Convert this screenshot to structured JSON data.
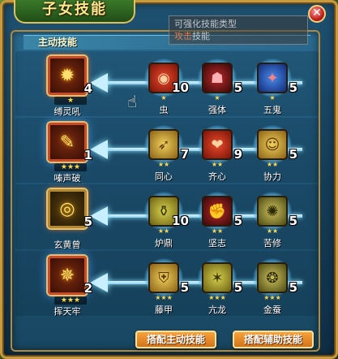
{
  "window": {
    "title": "子女技能",
    "close_label": "✕"
  },
  "tooltip": {
    "line1": "可强化技能类型",
    "line2_accent": "攻击",
    "line2_rest": "技能"
  },
  "section_title": "主动技能",
  "rows": [
    {
      "main": {
        "name": "缚灵吼",
        "level": "4",
        "stars": "★",
        "icon": "sun-burst-icon",
        "glyph": "✹"
      },
      "subs": [
        {
          "name": "虫",
          "level": "10",
          "stars": "★",
          "icon": "red-eye-icon",
          "glyph": "◉",
          "style": "ic-red"
        },
        {
          "name": "强体",
          "level": "5",
          "stars": "★",
          "icon": "demon-face-icon",
          "glyph": "☗",
          "style": "ic-darkred"
        },
        {
          "name": "五鬼",
          "level": "5",
          "stars": "★",
          "icon": "blue-ghost-icon",
          "glyph": "✦",
          "style": "ic-blue"
        }
      ]
    },
    {
      "main": {
        "name": "嗪声破",
        "level": "1",
        "stars": "★★★",
        "icon": "scroll-icon",
        "glyph": "✎"
      },
      "subs": [
        {
          "name": "同心",
          "level": "7",
          "stars": "★★",
          "icon": "horn-icon",
          "glyph": "➶",
          "style": "ic-gold"
        },
        {
          "name": "齐心",
          "level": "9",
          "stars": "★★",
          "icon": "heart-icon",
          "glyph": "❤",
          "style": "ic-red"
        },
        {
          "name": "协力",
          "level": "5",
          "stars": "★★",
          "icon": "character-icon",
          "glyph": "☺",
          "style": "ic-gold"
        }
      ]
    },
    {
      "main": {
        "name": "玄黄曾",
        "level": "5",
        "stars": "",
        "icon": "orb-icon",
        "glyph": "◎"
      },
      "subs": [
        {
          "name": "炉鼎",
          "level": "10",
          "stars": "★★",
          "icon": "cauldron-icon",
          "glyph": "⚱",
          "style": "ic-goldgreen"
        },
        {
          "name": "坚志",
          "level": "5",
          "stars": "★★",
          "icon": "fist-icon",
          "glyph": "✊",
          "style": "ic-darkred"
        },
        {
          "name": "苦修",
          "level": "5",
          "stars": "★★",
          "icon": "spiral-icon",
          "glyph": "✺",
          "style": "ic-olive"
        }
      ]
    },
    {
      "main": {
        "name": "挥天牢",
        "level": "2",
        "stars": "★★★",
        "icon": "flame-icon",
        "glyph": "✵"
      },
      "subs": [
        {
          "name": "藤甲",
          "level": "5",
          "stars": "★★★",
          "icon": "armor-icon",
          "glyph": "⛨",
          "style": "ic-gold"
        },
        {
          "name": "亢龙",
          "level": "5",
          "stars": "★★★",
          "icon": "dragon-icon",
          "glyph": "✶",
          "style": "ic-goldgreen"
        },
        {
          "name": "金蚕",
          "level": "5",
          "stars": "★★★",
          "icon": "silkworm-icon",
          "glyph": "❂",
          "style": "ic-olive"
        }
      ]
    }
  ],
  "buttons": {
    "active_label": "搭配主动技能",
    "support_label": "搭配辅助技能"
  },
  "colors": {
    "frame_gold": "#c99a3c",
    "panel_blue": "#1f5677",
    "button_orange": "#e88a2a",
    "star_yellow": "#ffd84a"
  }
}
